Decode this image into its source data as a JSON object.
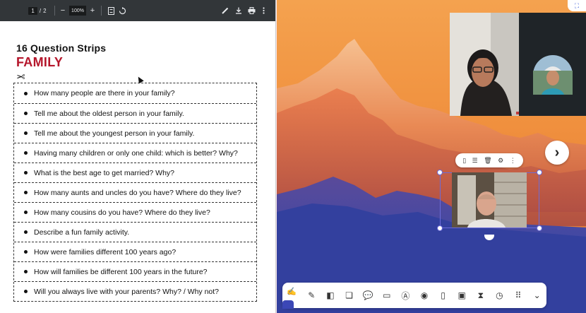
{
  "pdf_toolbar": {
    "page_current": "1",
    "page_separator": "/",
    "page_total": "2",
    "zoom_out": "−",
    "zoom_level": "100%",
    "zoom_in": "+"
  },
  "document": {
    "title": "16 Question Strips",
    "subtitle": "FAMILY",
    "strips": [
      "How many people are there in your family?",
      "Tell me about the oldest person in your family.",
      "Tell me about the youngest person in your family.",
      "Having many children or only one child: which is better?  Why?",
      "What is the best age to get married?  Why?",
      "How many aunts and uncles do you have?  Where do they live?",
      "How many cousins do you have?  Where do they live?",
      "Describe a fun family activity.",
      "How were families different 100 years ago?",
      "How will families be different 100 years in the future?",
      "Will you always live with your parents?  Why? / Why not?"
    ]
  },
  "board": {
    "next_glyph": "›",
    "colors": {
      "accent": "#6b6bd8",
      "sky": "#f0903e",
      "mountain_shadow": "#3b4aa8",
      "title_red": "#b5162b"
    }
  },
  "icons": {
    "pdf_toolbar": [
      "fit-page-icon",
      "rotate-icon",
      "pen-icon",
      "download-icon",
      "print-icon",
      "more-vert-icon"
    ],
    "selection_toolbar": [
      "split-icon",
      "layout-icon",
      "trash-icon",
      "settings-icon",
      "more-vert-icon"
    ],
    "bottom_toolbar": [
      "note-edit-icon",
      "shapes-icon",
      "sticker-icon",
      "chat-icon",
      "image-icon",
      "text-icon",
      "color-icon",
      "timer-icon",
      "media-icon",
      "hourglass-icon",
      "clock-icon",
      "apps-grid-icon",
      "chevron-down-icon"
    ]
  }
}
